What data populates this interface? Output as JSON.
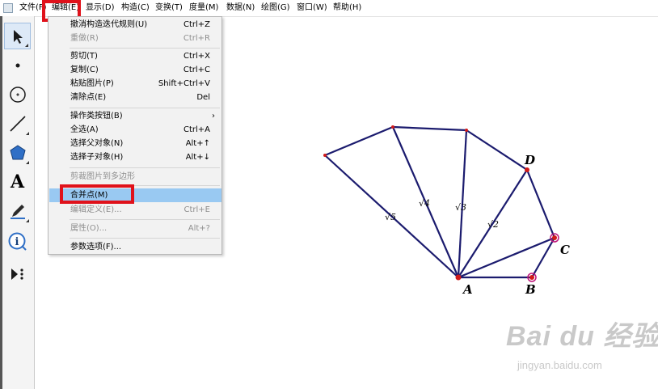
{
  "menubar": {
    "items": [
      {
        "label": "文件(F)"
      },
      {
        "label": "编辑(E)"
      },
      {
        "label": "显示(D)"
      },
      {
        "label": "构造(C)"
      },
      {
        "label": "变换(T)"
      },
      {
        "label": "度量(M)"
      },
      {
        "label": "数据(N)"
      },
      {
        "label": "绘图(G)"
      },
      {
        "label": "窗口(W)"
      },
      {
        "label": "帮助(H)"
      }
    ]
  },
  "toolbox": {
    "tools": [
      {
        "name": "select-arrow-icon"
      },
      {
        "name": "point-tool-icon"
      },
      {
        "name": "compass-tool-icon"
      },
      {
        "name": "line-tool-icon"
      },
      {
        "name": "polygon-tool-icon"
      },
      {
        "name": "text-tool-icon",
        "glyph": "A"
      },
      {
        "name": "marker-tool-icon"
      },
      {
        "name": "info-tool-icon",
        "glyph": "i"
      },
      {
        "name": "custom-tool-icon"
      }
    ]
  },
  "edit_menu": {
    "items": [
      {
        "label": "撤消构造迭代规则(U)",
        "shortcut": "Ctrl+Z"
      },
      {
        "label": "重做(R)",
        "shortcut": "Ctrl+R"
      },
      {
        "label": "剪切(T)",
        "shortcut": "Ctrl+X"
      },
      {
        "label": "复制(C)",
        "shortcut": "Ctrl+C"
      },
      {
        "label": "粘贴图片(P)",
        "shortcut": "Shift+Ctrl+V"
      },
      {
        "label": "清除点(E)",
        "shortcut": "Del"
      },
      {
        "label": "操作类按钮(B)",
        "submenu_arrow": "›"
      },
      {
        "label": "全选(A)",
        "shortcut": "Ctrl+A"
      },
      {
        "label": "选择父对象(N)",
        "shortcut": "Alt+↑"
      },
      {
        "label": "选择子对象(H)",
        "shortcut": "Alt+↓"
      },
      {
        "label": "剪裁图片到多边形"
      },
      {
        "label": "合并点(M)"
      },
      {
        "label": "编辑定义(E)...",
        "shortcut": "Ctrl+E"
      },
      {
        "label": "属性(O)...",
        "shortcut": "Alt+?"
      },
      {
        "label": "参数选项(F)..."
      }
    ]
  },
  "sketch": {
    "points": [
      {
        "label": "A"
      },
      {
        "label": "B"
      },
      {
        "label": "C"
      },
      {
        "label": "D"
      }
    ],
    "radicals": [
      {
        "label": "√2"
      },
      {
        "label": "√3"
      },
      {
        "label": "√4"
      },
      {
        "label": "√5"
      }
    ]
  },
  "watermark": {
    "brand": "Bai du 经验",
    "url": "jingyan.baidu.com"
  },
  "colors": {
    "segment": "#1b1b6e",
    "point": "#d11a1a",
    "selected_point": "#c0157a",
    "highlight_frame": "#e0121b",
    "menu_highlight": "#99c9f2"
  }
}
